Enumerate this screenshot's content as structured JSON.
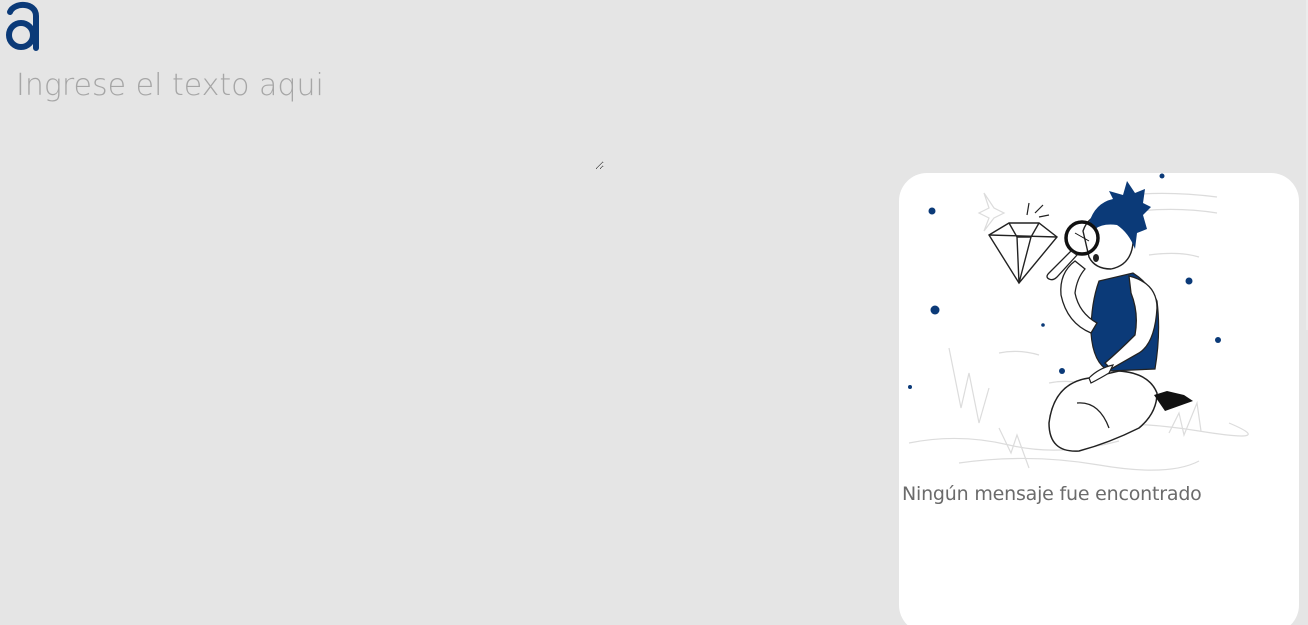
{
  "logo": {
    "icon": "brand-a-logo",
    "color": "#0b3a78"
  },
  "editor": {
    "placeholder": "Ingrese el texto aqui",
    "value": ""
  },
  "results": {
    "empty_message": "Ningún mensaje fue encontrado",
    "illustration": "person-with-magnifying-glass-diamond-illustration"
  },
  "colors": {
    "brand": "#0b3a78",
    "background": "#e5e5e5",
    "panel": "#ffffff"
  }
}
